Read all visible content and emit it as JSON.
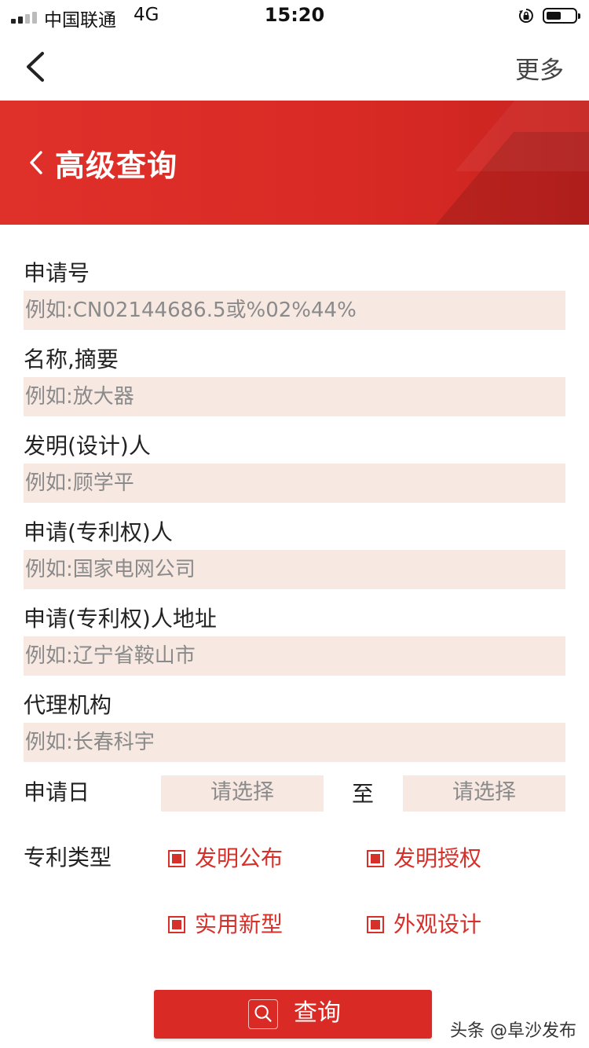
{
  "status_bar": {
    "carrier": "中国联通",
    "network": "4G",
    "time": "15:20"
  },
  "nav": {
    "back_icon": "chevron-left-icon",
    "more_label": "更多"
  },
  "banner": {
    "title": "高级查询",
    "color": "#d92a25"
  },
  "form": {
    "fields": [
      {
        "label": "申请号",
        "placeholder": "例如:CN02144686.5或%02%44%"
      },
      {
        "label": "名称,摘要",
        "placeholder": "例如:放大器"
      },
      {
        "label": "发明(设计)人",
        "placeholder": "例如:顾学平"
      },
      {
        "label": "申请(专利权)人",
        "placeholder": "例如:国家电网公司"
      },
      {
        "label": "申请(专利权)人地址",
        "placeholder": "例如:辽宁省鞍山市"
      },
      {
        "label": "代理机构",
        "placeholder": "例如:长春科宇"
      }
    ],
    "date": {
      "label": "申请日",
      "from_placeholder": "请选择",
      "separator": "至",
      "to_placeholder": "请选择"
    },
    "patent_type": {
      "label": "专利类型",
      "options": [
        {
          "label": "发明公布",
          "checked": true
        },
        {
          "label": "发明授权",
          "checked": true
        },
        {
          "label": "实用新型",
          "checked": true
        },
        {
          "label": "外观设计",
          "checked": true
        }
      ]
    },
    "search_button": "查询"
  },
  "watermark": "头条 @阜沙发布"
}
